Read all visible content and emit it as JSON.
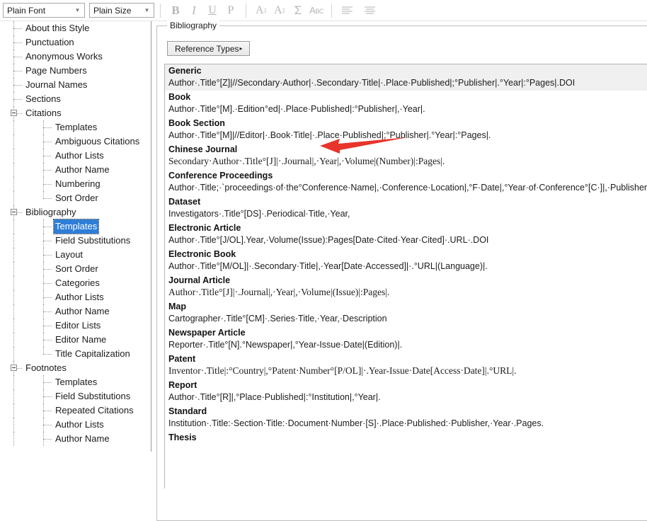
{
  "toolbar": {
    "font_select": {
      "value": "Plain Font",
      "arrow": "chevron-down-icon"
    },
    "size_select": {
      "value": "Plain Size",
      "arrow": "chevron-down-icon"
    },
    "bold_label": "B",
    "italic_label": "I",
    "underline_label": "U",
    "plain_label": "P",
    "superscript_label": "A",
    "superscript_sup": "1",
    "subscript_label": "A",
    "subscript_sub": "1",
    "symbol_label": "Σ",
    "spellcheck_label_big": "A",
    "spellcheck_label_small": "BC",
    "align_left_name": "align-left-icon",
    "align_center_name": "align-center-icon"
  },
  "tree": {
    "nodes": [
      {
        "label": "About this Style",
        "depth": 1,
        "expander": false,
        "selected": false
      },
      {
        "label": "Punctuation",
        "depth": 1,
        "expander": false,
        "selected": false
      },
      {
        "label": "Anonymous Works",
        "depth": 1,
        "expander": false,
        "selected": false
      },
      {
        "label": "Page Numbers",
        "depth": 1,
        "expander": false,
        "selected": false
      },
      {
        "label": "Journal Names",
        "depth": 1,
        "expander": false,
        "selected": false
      },
      {
        "label": "Sections",
        "depth": 1,
        "expander": false,
        "selected": false
      },
      {
        "label": "Citations",
        "depth": 1,
        "expander": true,
        "selected": false
      },
      {
        "label": "Templates",
        "depth": 2,
        "expander": false,
        "selected": false
      },
      {
        "label": "Ambiguous Citations",
        "depth": 2,
        "expander": false,
        "selected": false
      },
      {
        "label": "Author Lists",
        "depth": 2,
        "expander": false,
        "selected": false
      },
      {
        "label": "Author Name",
        "depth": 2,
        "expander": false,
        "selected": false
      },
      {
        "label": "Numbering",
        "depth": 2,
        "expander": false,
        "selected": false
      },
      {
        "label": "Sort Order",
        "depth": 2,
        "expander": false,
        "selected": false,
        "last": true
      },
      {
        "label": "Bibliography",
        "depth": 1,
        "expander": true,
        "selected": false
      },
      {
        "label": "Templates",
        "depth": 2,
        "expander": false,
        "selected": true
      },
      {
        "label": "Field Substitutions",
        "depth": 2,
        "expander": false,
        "selected": false
      },
      {
        "label": "Layout",
        "depth": 2,
        "expander": false,
        "selected": false
      },
      {
        "label": "Sort Order",
        "depth": 2,
        "expander": false,
        "selected": false
      },
      {
        "label": "Categories",
        "depth": 2,
        "expander": false,
        "selected": false
      },
      {
        "label": "Author Lists",
        "depth": 2,
        "expander": false,
        "selected": false
      },
      {
        "label": "Author Name",
        "depth": 2,
        "expander": false,
        "selected": false
      },
      {
        "label": "Editor Lists",
        "depth": 2,
        "expander": false,
        "selected": false
      },
      {
        "label": "Editor Name",
        "depth": 2,
        "expander": false,
        "selected": false
      },
      {
        "label": "Title Capitalization",
        "depth": 2,
        "expander": false,
        "selected": false,
        "last": true
      },
      {
        "label": "Footnotes",
        "depth": 1,
        "expander": true,
        "selected": false
      },
      {
        "label": "Templates",
        "depth": 2,
        "expander": false,
        "selected": false
      },
      {
        "label": "Field Substitutions",
        "depth": 2,
        "expander": false,
        "selected": false
      },
      {
        "label": "Repeated Citations",
        "depth": 2,
        "expander": false,
        "selected": false
      },
      {
        "label": "Author Lists",
        "depth": 2,
        "expander": false,
        "selected": false
      },
      {
        "label": "Author Name",
        "depth": 2,
        "expander": false,
        "selected": false
      }
    ]
  },
  "panel": {
    "group_title": "Bibliography",
    "reference_types_button": "Reference Types",
    "reference_types_caret": "▸"
  },
  "templates": [
    {
      "type": "Generic",
      "serif": false,
      "shaded": true,
      "pattern": "Author·.Title°[Z]|//Secondary·Author|·.Secondary·Title|·.Place·Published|;°Publisher|.°Year|:°Pages|.DOI"
    },
    {
      "type": "Book",
      "serif": false,
      "shaded": false,
      "pattern": "Author·.Title°[M].·Edition°ed|·.Place·Published|:°Publisher|,·Year|."
    },
    {
      "type": "Book Section",
      "serif": false,
      "shaded": false,
      "pattern": "Author·.Title°[M]|//Editor|·.Book·Title|·.Place·Published|;°Publisher|.°Year|:°Pages|."
    },
    {
      "type": "Chinese Journal",
      "serif": true,
      "shaded": false,
      "pattern": "Secondary·Author·.Title°[J]|·.Journal|,·Year|,·Volume|(Number)|:Pages|."
    },
    {
      "type": "Conference Proceedings",
      "serif": false,
      "shaded": false,
      "pattern": "Author·.Title;·`proceedings·of·the°Conference·Name|,·Conference·Location|,°F·Date|,°Year·of·Conference°[C·]|,·Publisher|:°Place·Pub"
    },
    {
      "type": "Dataset",
      "serif": false,
      "shaded": false,
      "pattern": "Investigators·.Title°[DS]·.Periodical·Title,·Year,"
    },
    {
      "type": "Electronic Article",
      "serif": false,
      "shaded": false,
      "pattern": "Author·.Title°[J/OL].Year,·Volume(Issue):Pages[Date·Cited·Year·Cited]·.URL·.DOI"
    },
    {
      "type": "Electronic Book",
      "serif": false,
      "shaded": false,
      "pattern": "Author·.Title°[M/OL]|·.Secondary·Title|,·Year[Date·Accessed]|·.°URL|(Language)|."
    },
    {
      "type": "Journal Article",
      "serif": true,
      "shaded": false,
      "pattern": "Author·.Title°[J]|·.Journal|,·Year|,·Volume|(Issue)|:Pages|."
    },
    {
      "type": "Map",
      "serif": false,
      "shaded": false,
      "pattern": "Cartographer·.Title°[CM]·.Series·Title,·Year,·Description"
    },
    {
      "type": "Newspaper Article",
      "serif": false,
      "shaded": false,
      "pattern": "Reporter·.Title°[N].°Newspaper|,°Year-Issue·Date|(Edition)|."
    },
    {
      "type": "Patent",
      "serif": true,
      "shaded": false,
      "pattern": "Inventor·.Title|:°Country|,°Patent·Number°[P/OL]|·.Year-Issue·Date[Access·Date]|.°URL|."
    },
    {
      "type": "Report",
      "serif": false,
      "shaded": false,
      "pattern": "Author·.Title°[R]|,°Place·Published|:°Institution|,°Year|."
    },
    {
      "type": "Standard",
      "serif": false,
      "shaded": false,
      "pattern": "Institution·.Title:·Section·Title:·Document·Number·[S]·.Place·Published:·Publisher,·Year·.Pages."
    },
    {
      "type": "Thesis",
      "serif": false,
      "shaded": false,
      "pattern": ""
    }
  ],
  "annotation": {
    "arrow_name": "red-arrow-annotation",
    "color": "#e8342a",
    "direction": "left",
    "points_at": "Chinese Journal"
  }
}
